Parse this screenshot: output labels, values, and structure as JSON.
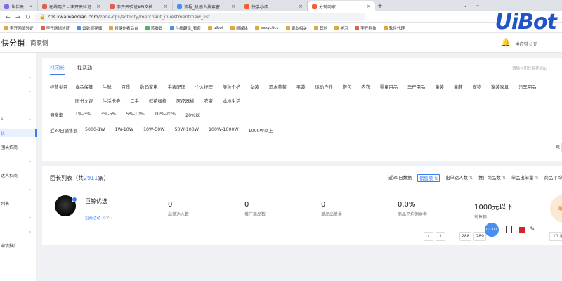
{
  "browser": {
    "tabs": [
      {
        "label": "伙伴云",
        "color": "#7a6cf0"
      },
      {
        "label": "在线用户 - 李开云验证",
        "color": "#e35d4a"
      },
      {
        "label": "李开云验证API文档",
        "color": "#e35d4a"
      },
      {
        "label": "流程_机器人搜索窗",
        "color": "#4a8ff0"
      },
      {
        "label": "快手小店",
        "color": "#ff5b2e"
      },
      {
        "label": "分销商家",
        "color": "#ff5b2e"
      }
    ],
    "url_host": "cps.kwaixiaodian.com",
    "url_path": "/zone-cps/activity/merchant_investment/new_list",
    "bookmarks": [
      "李开网络验证",
      "李开网络验证",
      "云数据存储",
      "按键作者后台",
      "蓝奏云",
      "在线翻译_有道",
      "uibot",
      "新媒体",
      "easyclick",
      "脚本相关",
      "其他",
      "学习",
      "李开科技",
      "软件代理"
    ]
  },
  "logo_text": "UiBot",
  "header": {
    "brand": "快分销",
    "merchant": "商家侧",
    "shop_name": "供应链公司"
  },
  "sidebar": {
    "items": [
      {
        "label": "",
        "chev": "⌄",
        "state": ""
      },
      {
        "label": "",
        "chev": "⌄",
        "state": ""
      },
      {
        "label": "",
        "chev": "",
        "state": ""
      },
      {
        "label": "1",
        "chev": "⌄",
        "state": "active-red"
      },
      {
        "label": "长",
        "chev": "",
        "state": "selected"
      },
      {
        "label": "团长招商",
        "chev": "",
        "state": ""
      },
      {
        "label": "",
        "chev": "⌄",
        "state": ""
      },
      {
        "label": "达人招商",
        "chev": "",
        "state": ""
      },
      {
        "label": "",
        "chev": "⌄",
        "state": ""
      },
      {
        "label": "列表",
        "chev": "",
        "state": ""
      },
      {
        "label": "",
        "chev": "⌄",
        "state": ""
      },
      {
        "label": "",
        "chev": "⌄",
        "state": ""
      },
      {
        "label": "申请推广",
        "chev": "",
        "state": ""
      }
    ]
  },
  "filter": {
    "tabs": [
      "找团长",
      "找活动"
    ],
    "search_placeholder": "请输入团长名称或ID",
    "rows": [
      {
        "label": "经营类目",
        "chips": [
          "食品保健",
          "生鲜",
          "百货",
          "数码家电",
          "手表配饰",
          "个人护理",
          "美妆个护",
          "女装",
          "酒水茶茶",
          "男装",
          "运动户外",
          "鞋包",
          "内衣",
          "婴童用品",
          "孕产用品",
          "童装",
          "童鞋",
          "宠物",
          "家装家具",
          "汽车用品",
          "图书文娱",
          "生活卡券",
          "二手",
          "鲜花绿植",
          "医疗器械",
          "农资",
          "本地生活"
        ]
      },
      {
        "label": "佣金率",
        "chips": [
          "1%-3%",
          "3%-5%",
          "5%-10%",
          "10%-20%",
          "20%以上"
        ]
      },
      {
        "label": "近30日销售额",
        "chips": [
          "5000-1W",
          "1W-10W",
          "10W-50W",
          "50W-100W",
          "100W-1000W",
          "1000W以上"
        ]
      }
    ],
    "more_btn": "更"
  },
  "list": {
    "title_prefix": "团长列表（共",
    "count": "2911",
    "title_suffix": "条）",
    "sorts": [
      "近30日数据",
      "销售额",
      "出单达人数",
      "推广商品数",
      "单品出单量",
      "商品平均佣"
    ],
    "active_sort": "销售额"
  },
  "leader": {
    "name": "巨鲸优选",
    "recruit_label": "招商活动",
    "recruit_count": "0个 ›",
    "stats": [
      {
        "value": "0",
        "label": "出单达人数"
      },
      {
        "value": "0",
        "label": "推广商品数"
      },
      {
        "value": "0",
        "label": "单品出单量"
      },
      {
        "value": "0.0%",
        "label": "商品平均佣金率"
      },
      {
        "value": "1000元以下",
        "label": "销售额"
      }
    ],
    "detail_label": "联系"
  },
  "pager": {
    "items": [
      "‹",
      "1",
      "···",
      "288",
      "289"
    ],
    "page_size": "10 条"
  },
  "recorder": {
    "time": "01:07",
    "pause": "❙❙",
    "pen": "✎"
  }
}
